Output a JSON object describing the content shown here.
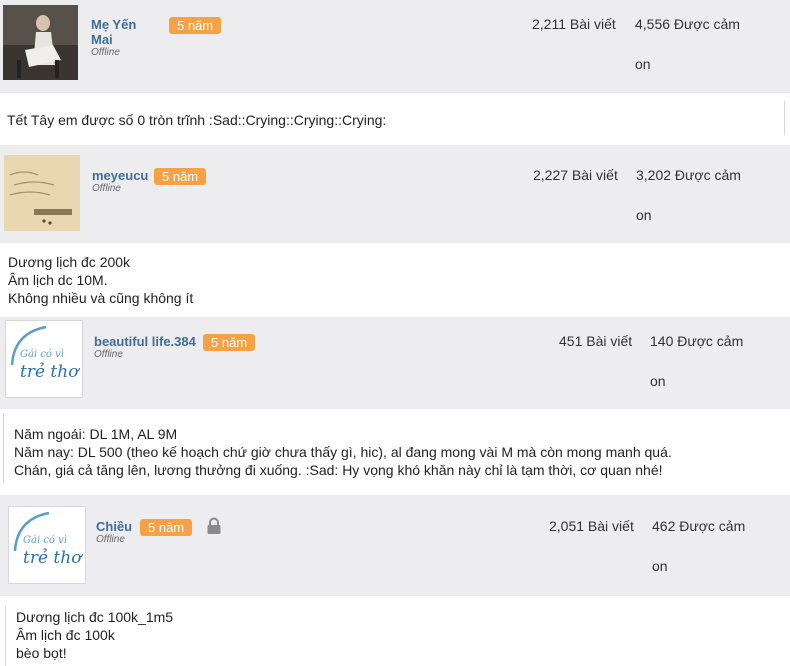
{
  "posts": [
    {
      "username": "Mẹ Yến Mai",
      "status": "Offline",
      "badge": "5 năm",
      "posts_count": "2,211 Bài viết",
      "thanks": "4,556 Được cảm",
      "thanks_suffix": "on",
      "content": [
        "Tết Tây em được số 0 tròn trĩnh :Sad::Crying::Crying::Crying:"
      ]
    },
    {
      "username": "meyeucu",
      "status": "Offline",
      "badge": "5 năm",
      "posts_count": "2,227 Bài viết",
      "thanks": "3,202 Được cảm",
      "thanks_suffix": "on",
      "content": [
        "Dương lịch đc 200k",
        "Âm lịch dc 10M.",
        "Không nhiều và cũng không ít"
      ]
    },
    {
      "username": "beautiful life.384",
      "status": "Offline",
      "badge": "5 năm",
      "posts_count": "451 Bài viết",
      "thanks": "140 Được cảm",
      "thanks_suffix": "on",
      "avatar_text": [
        "Gái có vì",
        "trẻ thơ"
      ],
      "content": [
        "Năm ngoái: DL 1M, AL 9M",
        "Năm nay: DL 500 (theo kế hoạch chứ giờ chưa thấy gì, hic), al đang mong vài M mà còn mong manh quá.",
        "Chán, giá cả tăng lên, lương thưởng đi xuống. :Sad: Hy vọng khó khăn này chỉ là tạm thời, cơ quan nhé!"
      ]
    },
    {
      "username": "Chiều",
      "status": "Offline",
      "badge": "5 năm",
      "posts_count": "2,051 Bài viết",
      "thanks": "462 Được cảm",
      "thanks_suffix": "on",
      "avatar_text": [
        "Gái có vì",
        "trẻ thơ"
      ],
      "content": [
        "Dương lịch đc 100k_1m5",
        "Âm lịch đc 100k",
        "bèo bọt!"
      ]
    }
  ],
  "colors": {
    "header_bg": "#edecef",
    "badge": "#f5a246",
    "username": "#3f6e9a"
  }
}
